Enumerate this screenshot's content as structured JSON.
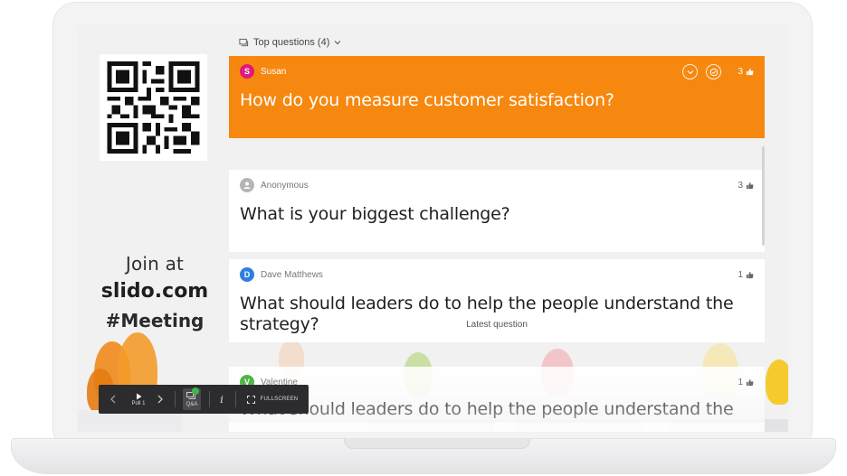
{
  "header": {
    "label": "Top questions (4)",
    "icon": "chat-icon"
  },
  "join": {
    "line1": "Join at",
    "line2": "slido.com",
    "line3": "#Meeting"
  },
  "colors": {
    "accent": "#f6880f",
    "toolbar": "#2c2c2e",
    "badge": "#3fb44c"
  },
  "questions": [
    {
      "author": "Susan",
      "initial": "S",
      "avatar_color": "#e0197d",
      "text": "How do you measure customer satisfaction?",
      "likes": "3",
      "active": true
    },
    {
      "author": "Anonymous",
      "initial": "",
      "avatar_color": "#b5b5b5",
      "text": "What is your biggest challenge?",
      "likes": "3"
    },
    {
      "author": "Dave Matthews",
      "initial": "D",
      "avatar_color": "#2f7de1",
      "text_line1": "What should leaders do to help the people understand the",
      "text_line2": "strategy?",
      "likes": "1"
    },
    {
      "author": "Valentine",
      "initial": "V",
      "avatar_color": "#4bb543",
      "text": "What should leaders do to help the people understand the",
      "likes": "1"
    }
  ],
  "latest_label": "Latest question",
  "toolbar": {
    "poll_label": "Poll 1",
    "qa_label": "Q&A",
    "info_label": "i",
    "fullscreen_label": "FULLSCREEN"
  }
}
